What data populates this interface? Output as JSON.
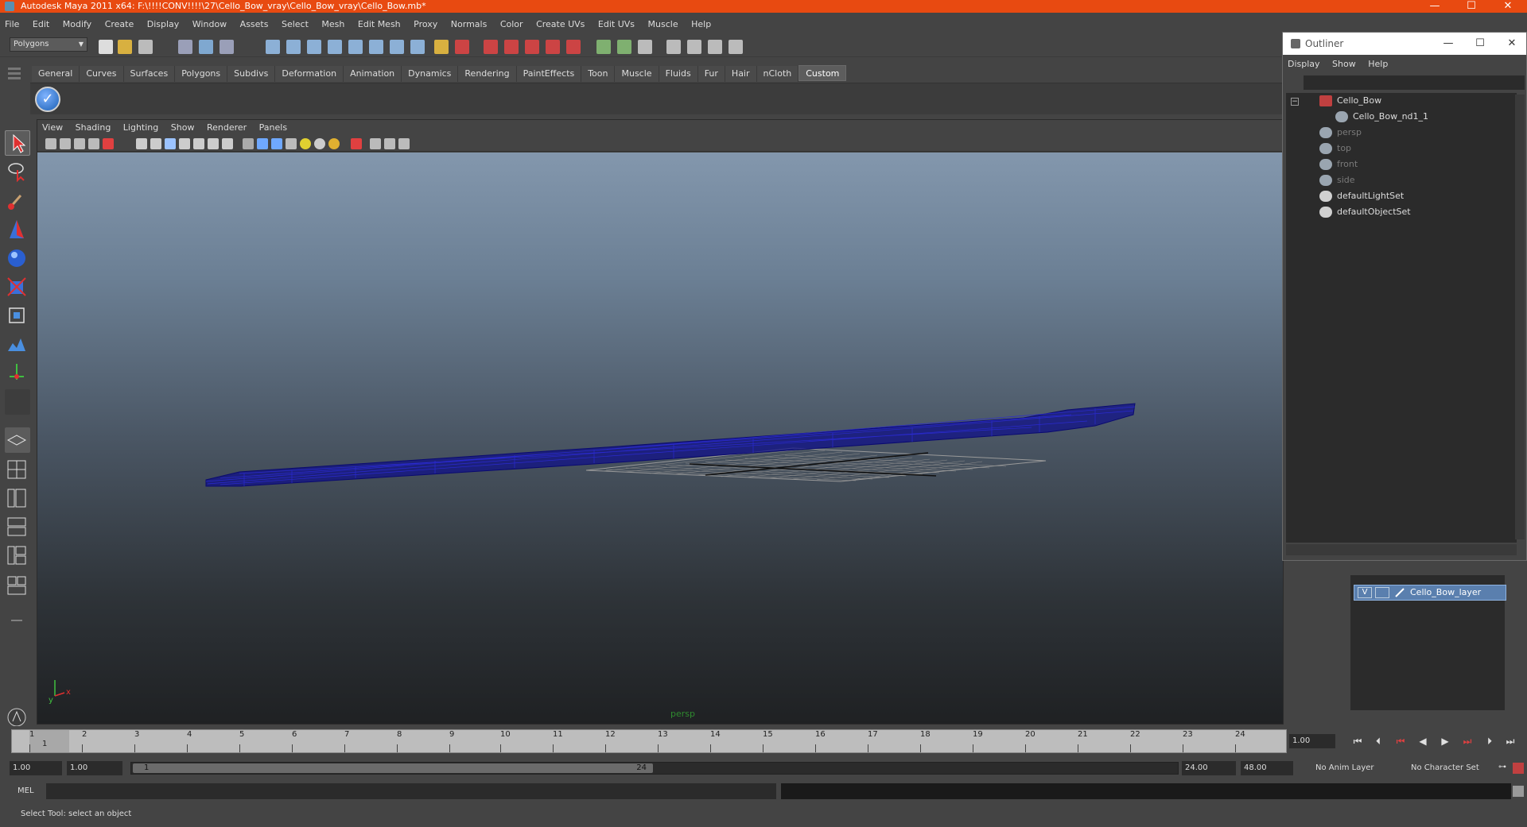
{
  "window": {
    "title": "Autodesk Maya 2011 x64: F:\\!!!!CONV!!!!\\27\\Cello_Bow_vray\\Cello_Bow_vray\\Cello_Bow.mb*",
    "minimize": "—",
    "maximize": "☐",
    "close": "✕"
  },
  "menubar": [
    "File",
    "Edit",
    "Modify",
    "Create",
    "Display",
    "Window",
    "Assets",
    "Select",
    "Mesh",
    "Edit Mesh",
    "Proxy",
    "Normals",
    "Color",
    "Create UVs",
    "Edit UVs",
    "Muscle",
    "Help"
  ],
  "status_line": {
    "mode": "Polygons"
  },
  "shelf": {
    "tabs": [
      "General",
      "Curves",
      "Surfaces",
      "Polygons",
      "Subdivs",
      "Deformation",
      "Animation",
      "Dynamics",
      "Rendering",
      "PaintEffects",
      "Toon",
      "Muscle",
      "Fluids",
      "Fur",
      "Hair",
      "nCloth",
      "Custom"
    ],
    "active_tab": "Custom",
    "button_icon": "checkmark-icon"
  },
  "viewport": {
    "menu": [
      "View",
      "Shading",
      "Lighting",
      "Show",
      "Renderer",
      "Panels"
    ],
    "camera": "persp"
  },
  "outliner": {
    "title": "Outliner",
    "menu": [
      "Display",
      "Show",
      "Help"
    ],
    "items": [
      {
        "label": "Cello_Bow",
        "dim": false
      },
      {
        "label": "Cello_Bow_nd1_1",
        "dim": false
      },
      {
        "label": "persp",
        "dim": true
      },
      {
        "label": "top",
        "dim": true
      },
      {
        "label": "front",
        "dim": true
      },
      {
        "label": "side",
        "dim": true
      },
      {
        "label": "defaultLightSet",
        "dim": false
      },
      {
        "label": "defaultObjectSet",
        "dim": false
      }
    ]
  },
  "layers": {
    "layer_name": "Cello_Bow_layer",
    "visible_flag": "V"
  },
  "time_slider": {
    "ticks": [
      "1",
      "2",
      "3",
      "4",
      "5",
      "6",
      "7",
      "8",
      "9",
      "10",
      "11",
      "12",
      "13",
      "14",
      "15",
      "16",
      "17",
      "18",
      "19",
      "20",
      "21",
      "22",
      "23",
      "24"
    ],
    "current_frame": "1",
    "current_time_field": "1.00"
  },
  "range_slider": {
    "start_time": "1.00",
    "playback_start": "1.00",
    "range_start_label": "1",
    "range_end_label": "24",
    "playback_end": "24.00",
    "end_time": "48.00",
    "anim_layer": "No Anim Layer",
    "character_set": "No Character Set"
  },
  "command_line": {
    "label": "MEL"
  },
  "help_line": "Select Tool: select an object",
  "colors": {
    "titlebar": "#e84a11",
    "wireframe": "#0b0b8a",
    "layer_highlight": "#5a7fae"
  }
}
